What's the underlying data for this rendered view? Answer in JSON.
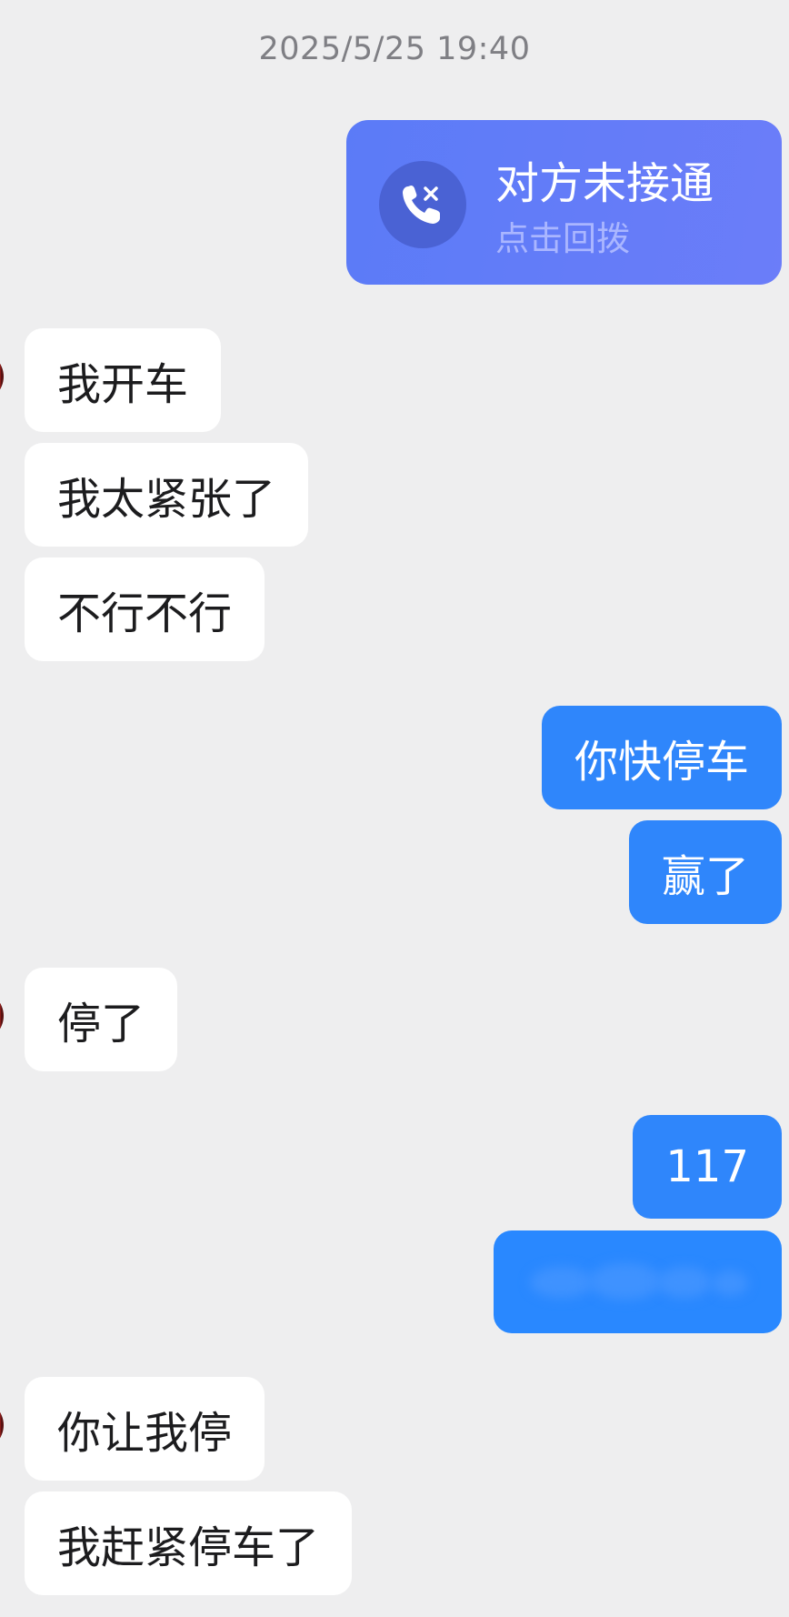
{
  "timestamp": "2025/5/25 19:40",
  "call_card": {
    "title": "对方未接通",
    "subtitle": "点击回拨",
    "icon": "missed-call-icon"
  },
  "messages": [
    {
      "side": "in",
      "text": "我开车"
    },
    {
      "side": "in",
      "text": "我太紧张了"
    },
    {
      "side": "in",
      "text": "不行不行"
    },
    {
      "side": "out",
      "text": "你快停车"
    },
    {
      "side": "out",
      "text": "赢了"
    },
    {
      "side": "in",
      "text": "停了"
    },
    {
      "side": "out",
      "text": "117"
    },
    {
      "side": "out",
      "text": ""
    },
    {
      "side": "in",
      "text": "你让我停"
    },
    {
      "side": "in",
      "text": "我赶紧停车了"
    }
  ],
  "colors": {
    "background": "#eeeeef",
    "incoming_bubble": "#ffffff",
    "outgoing_bubble": "#2f86fb",
    "call_card": "#5b7bf7"
  }
}
